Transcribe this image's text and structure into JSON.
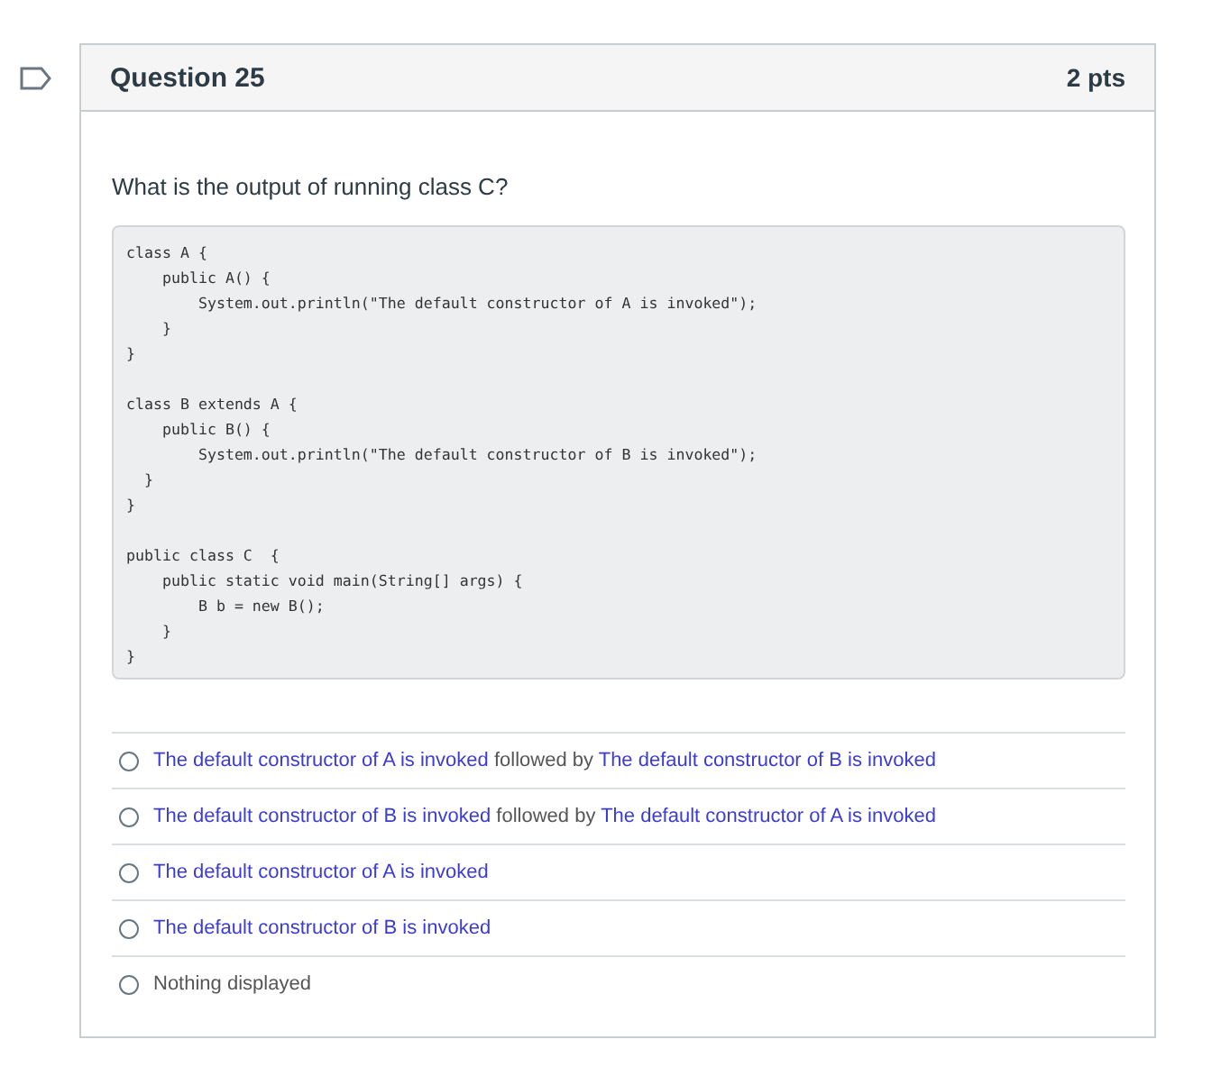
{
  "question": {
    "title": "Question 25",
    "points": "2 pts",
    "flagged": false,
    "prompt": "What is the output of running class C?",
    "code": "class A {\n    public A() {\n        System.out.println(\"The default constructor of A is invoked\");\n    }\n}\n\nclass B extends A {\n    public B() {\n        System.out.println(\"The default constructor of B is invoked\");\n  }\n}\n\npublic class C  {\n    public static void main(String[] args) {\n        B b = new B();\n    }\n}",
    "answers": [
      {
        "selected": false,
        "parts": [
          {
            "kind": "quoted",
            "text": "The default constructor of A is invoked"
          },
          {
            "kind": "plain",
            "text": " followed by "
          },
          {
            "kind": "quoted",
            "text": "The default constructor of B is invoked"
          }
        ]
      },
      {
        "selected": false,
        "parts": [
          {
            "kind": "quoted",
            "text": "The default constructor of B is invoked"
          },
          {
            "kind": "plain",
            "text": " followed by "
          },
          {
            "kind": "quoted",
            "text": "The default constructor of A is invoked"
          }
        ]
      },
      {
        "selected": false,
        "parts": [
          {
            "kind": "quoted",
            "text": "The default constructor of A is invoked"
          }
        ]
      },
      {
        "selected": false,
        "parts": [
          {
            "kind": "quoted",
            "text": "The default constructor of B is invoked"
          }
        ]
      },
      {
        "selected": false,
        "parts": [
          {
            "kind": "plain",
            "text": "Nothing displayed"
          }
        ]
      }
    ]
  }
}
